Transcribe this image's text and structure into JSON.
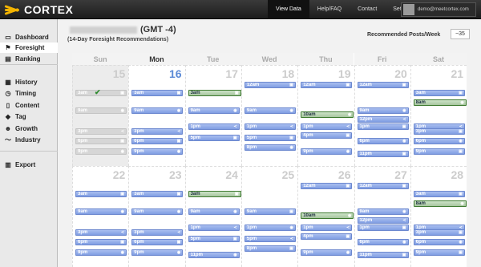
{
  "app": {
    "name": "CORTEX"
  },
  "nav": {
    "items": [
      {
        "label": "View Data",
        "active": true
      },
      {
        "label": "Help/FAQ",
        "active": false
      },
      {
        "label": "Contact",
        "active": false
      },
      {
        "label": "Settings",
        "active": false
      }
    ],
    "user_email": "demo@meetcortex.com"
  },
  "sidebar": {
    "items": [
      {
        "label": "Dashboard",
        "icon": "monitor-icon"
      },
      {
        "label": "Foresight",
        "icon": "flag-icon",
        "active": true
      },
      {
        "label": "Ranking",
        "icon": "ranking-icon"
      },
      {
        "label": "History",
        "icon": "calendar-icon"
      },
      {
        "label": "Timing",
        "icon": "clock-icon"
      },
      {
        "label": "Content",
        "icon": "document-icon"
      },
      {
        "label": "Tag",
        "icon": "tag-icon"
      },
      {
        "label": "Growth",
        "icon": "users-icon"
      },
      {
        "label": "Industry",
        "icon": "trend-line-icon"
      },
      {
        "label": "Export",
        "icon": "export-icon"
      }
    ]
  },
  "header": {
    "title_suffix": "(GMT -4)",
    "subtitle": "(14-Day Foresight Recommendations)",
    "recommended_label": "Recommended Posts/Week",
    "recommended_value": "~35"
  },
  "colors": {
    "slot_blue": "#8aa6e6",
    "slot_green_border": "#3d7a2f",
    "today": "#5b8ad6"
  },
  "calendar": {
    "days": [
      "Sun",
      "Mon",
      "Tue",
      "Wed",
      "Thu",
      "Fri",
      "Sat"
    ],
    "today_index": 1,
    "weeks": [
      {
        "dates": [
          "15",
          "16",
          "17",
          "18",
          "19",
          "20",
          "21"
        ],
        "slots": [
          [
            {
              "t": "3am",
              "k": "gray",
              "done": true
            },
            {
              "t": "9am",
              "k": "gray"
            },
            {
              "t": "3pm",
              "k": "gray"
            },
            {
              "t": "6pm",
              "k": "gray"
            },
            {
              "t": "9pm",
              "k": "gray"
            }
          ],
          [
            {
              "t": "3am"
            },
            {
              "t": "9am"
            },
            {
              "t": "3pm"
            },
            {
              "t": "6pm"
            },
            {
              "t": "9pm"
            }
          ],
          [
            {
              "t": "3am",
              "k": "green"
            },
            {
              "t": "9am"
            },
            {
              "t": "1pm"
            },
            {
              "t": "5pm"
            }
          ],
          [
            {
              "t": "12am"
            },
            {
              "t": "9am"
            },
            {
              "t": "1pm"
            },
            {
              "t": "5pm"
            },
            {
              "t": "8pm"
            }
          ],
          [
            {
              "t": "12am"
            },
            {
              "t": "10am",
              "k": "green"
            },
            {
              "t": "1pm"
            },
            {
              "t": "4pm"
            },
            {
              "t": "9pm"
            }
          ],
          [
            {
              "t": "12am"
            },
            {
              "t": "9am"
            },
            {
              "t": "12pm"
            },
            {
              "t": "1pm"
            },
            {
              "t": "6pm"
            },
            {
              "t": "11pm"
            }
          ],
          [
            {
              "t": "3am"
            },
            {
              "t": "8am",
              "k": "green"
            },
            {
              "t": "1pm"
            },
            {
              "t": "3pm"
            },
            {
              "t": "6pm"
            },
            {
              "t": "9pm"
            }
          ]
        ]
      },
      {
        "dates": [
          "22",
          "23",
          "24",
          "25",
          "26",
          "27",
          "28"
        ],
        "slots": [
          [
            {
              "t": "3am"
            },
            {
              "t": "9am"
            },
            {
              "t": "3pm"
            },
            {
              "t": "6pm"
            },
            {
              "t": "9pm"
            }
          ],
          [
            {
              "t": "3am"
            },
            {
              "t": "9am"
            },
            {
              "t": "3pm"
            },
            {
              "t": "6pm"
            },
            {
              "t": "9pm"
            }
          ],
          [
            {
              "t": "3am",
              "k": "green"
            },
            {
              "t": "9am"
            },
            {
              "t": "1pm"
            },
            {
              "t": "5pm"
            },
            {
              "t": "11pm"
            }
          ],
          [
            {
              "t": "9am"
            },
            {
              "t": "1pm"
            },
            {
              "t": "5pm"
            },
            {
              "t": "8pm"
            }
          ],
          [
            {
              "t": "12am"
            },
            {
              "t": "10am",
              "k": "green"
            },
            {
              "t": "1pm"
            },
            {
              "t": "4pm"
            },
            {
              "t": "9pm"
            }
          ],
          [
            {
              "t": "12am"
            },
            {
              "t": "9am"
            },
            {
              "t": "12pm"
            },
            {
              "t": "1pm"
            },
            {
              "t": "6pm"
            },
            {
              "t": "11pm"
            }
          ],
          [
            {
              "t": "3am"
            },
            {
              "t": "8am",
              "k": "green"
            },
            {
              "t": "1pm"
            },
            {
              "t": "3pm"
            },
            {
              "t": "6pm"
            },
            {
              "t": "9pm"
            }
          ]
        ]
      }
    ]
  }
}
